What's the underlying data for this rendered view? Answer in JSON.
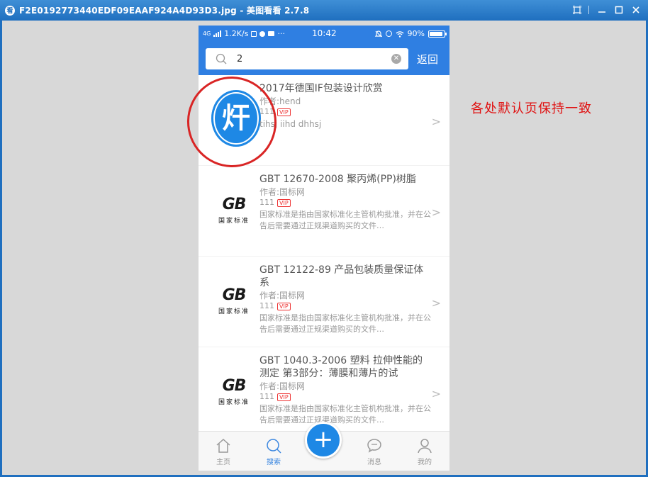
{
  "window": {
    "app_icon": "看",
    "title": "F2E0192773440EDF09EAAF924A4D93D3.jpg - 美图看看 2.7.8",
    "controls": [
      "fit-icon",
      "minimize-icon",
      "maximize-icon",
      "close-icon"
    ]
  },
  "phone": {
    "status": {
      "network": "4G",
      "speed": "1.2K/s",
      "time": "10:42",
      "battery": "90%",
      "battery_level": 0.9
    },
    "search": {
      "value": "2",
      "back_label": "返回"
    },
    "results": [
      {
        "thumb": "logo-badge",
        "title": "2017年德国IF包装设计欣赏",
        "author": "作者:hend",
        "count": "111",
        "vip": "VIP",
        "tags": "tihsj iihd dhhsj"
      },
      {
        "thumb": "gb-logo",
        "title": "GBT 12670-2008 聚丙烯(PP)树脂",
        "author": "作者:国标网",
        "count": "111",
        "vip": "VIP",
        "desc": "国家标准是指由国家标准化主管机构批准，并在公告后需要通过正规渠道购买的文件…"
      },
      {
        "thumb": "gb-logo",
        "title": "GBT 12122-89 产品包装质量保证体系",
        "author": "作者:国标网",
        "count": "111",
        "vip": "VIP",
        "desc": "国家标准是指由国家标准化主管机构批准，并在公告后需要通过正规渠道购买的文件…"
      },
      {
        "thumb": "gb-logo",
        "title": "GBT 1040.3-2006 塑料 拉伸性能的测定 第3部分：薄膜和薄片的试",
        "author": "作者:国标网",
        "count": "111",
        "vip": "VIP",
        "desc": "国家标准是指由国家标准化主管机构批准，并在公告后需要通过正规渠道购买的文件…"
      }
    ],
    "gb_logo": {
      "mark": "GB",
      "text": "国家标准"
    },
    "tabs": {
      "home": "主页",
      "search": "搜索",
      "add": "+",
      "messages": "消息",
      "mine": "我的"
    },
    "accent_color": "#2f7fe2"
  },
  "annotation": {
    "note": "各处默认页保持一致",
    "color": "#e01010"
  }
}
